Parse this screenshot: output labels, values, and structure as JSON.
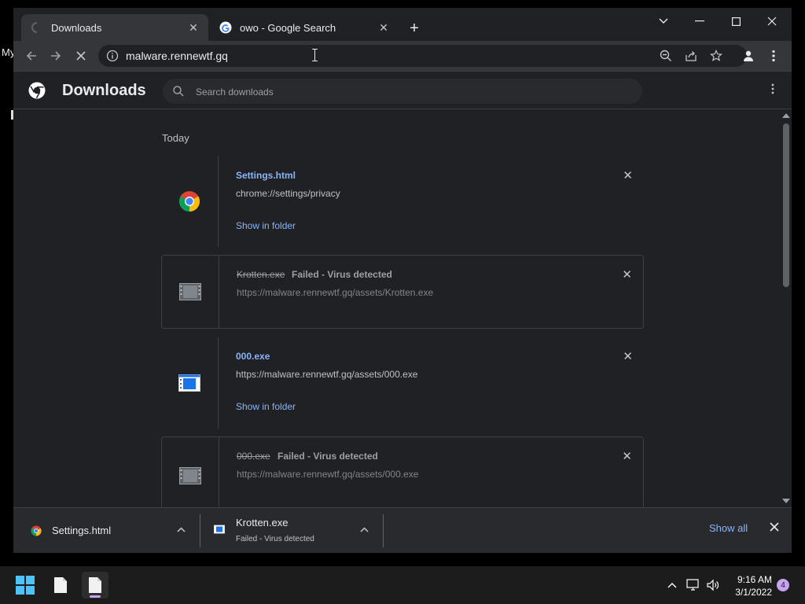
{
  "desktop": {
    "label": "My"
  },
  "tabs": [
    {
      "title": "Downloads",
      "active": true
    },
    {
      "title": "owo - Google Search",
      "active": false
    }
  ],
  "toolbar": {
    "url": "malware.rennewtf.gq"
  },
  "downloads_page": {
    "title": "Downloads",
    "search_placeholder": "Search downloads",
    "date_label": "Today",
    "items": [
      {
        "name": "Settings.html",
        "url": "chrome://settings/privacy",
        "status": "",
        "action": "Show in folder",
        "icon": "chrome-icon"
      },
      {
        "name": "Krotten.exe",
        "url": "https://malware.rennewtf.gq/assets/Krotten.exe",
        "status": "Failed - Virus detected",
        "action": "",
        "icon": "file-icon"
      },
      {
        "name": "000.exe",
        "url": "https://malware.rennewtf.gq/assets/000.exe",
        "status": "",
        "action": "Show in folder",
        "icon": "exe-icon"
      },
      {
        "name": "000.exe",
        "url": "https://malware.rennewtf.gq/assets/000.exe",
        "status": "Failed - Virus detected",
        "action": "",
        "icon": "file-icon"
      }
    ]
  },
  "shelf": {
    "items": [
      {
        "name": "Settings.html",
        "status": ""
      },
      {
        "name": "Krotten.exe",
        "status": "Failed - Virus detected"
      }
    ],
    "show_all": "Show all"
  },
  "taskbar": {
    "time": "9:16 AM",
    "date": "3/1/2022",
    "notification_count": "4"
  },
  "colors": {
    "accent_link": "#8ab4f8",
    "page_bg": "#202124",
    "toolbar_bg": "#35363a"
  }
}
